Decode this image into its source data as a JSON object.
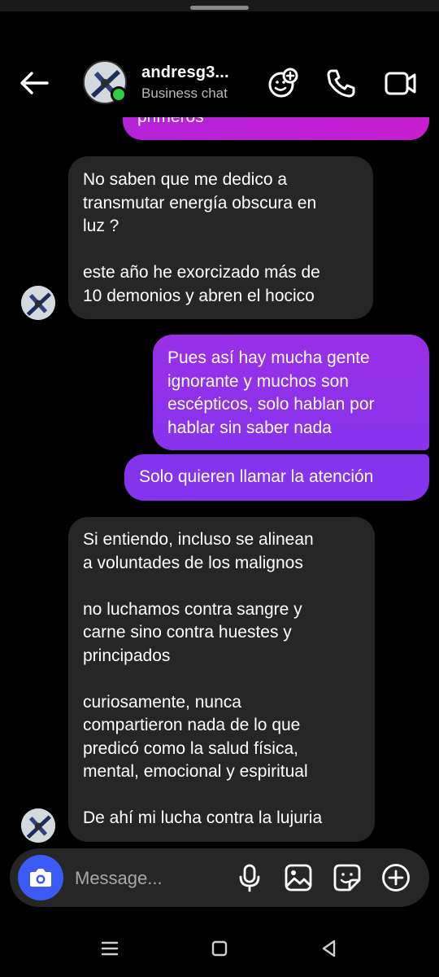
{
  "header": {
    "username": "andresg3...",
    "subtitle": "Business chat"
  },
  "messages": [
    {
      "id": "m0",
      "from": "me",
      "text": "primeros"
    },
    {
      "id": "m1",
      "from": "them",
      "text": "No saben que me dedico a\ntransmutar energía obscura en\nluz ?\n\neste año he exorcizado más de\n10 demonios y abren el hocico"
    },
    {
      "id": "m2",
      "from": "me",
      "text": "Pues así hay mucha gente\nignorante y muchos son\nescépticos, solo hablan por\nhablar sin saber nada"
    },
    {
      "id": "m3",
      "from": "me",
      "text": "Solo quieren llamar la atención"
    },
    {
      "id": "m4",
      "from": "them",
      "text": "Si entiendo, incluso se alinean\na voluntades de los malignos\n\nno luchamos contra sangre y\ncarne sino contra huestes y\nprincipados\n\ncuriosamente, nunca\ncompartieron nada de lo que\npredicó como la salud física,\nmental, emocional y espiritual\n\nDe ahí mi lucha contra la lujuria"
    }
  ],
  "composer": {
    "placeholder": "Message..."
  },
  "colors": {
    "sent_bubble": "#8b2ee8",
    "received_bubble": "#262626",
    "camera_button": "#3c5bf5",
    "online_dot": "#2ecc40"
  },
  "icons": {
    "back": "arrow-left-icon",
    "effects": "sticker-face-add-icon",
    "call": "phone-icon",
    "video": "video-camera-icon",
    "camera": "camera-icon",
    "mic": "microphone-icon",
    "gallery": "image-icon",
    "sticker": "sticker-icon",
    "plus": "plus-circle-icon",
    "nav_recents": "menu-lines-icon",
    "nav_home": "square-icon",
    "nav_back": "triangle-back-icon"
  }
}
